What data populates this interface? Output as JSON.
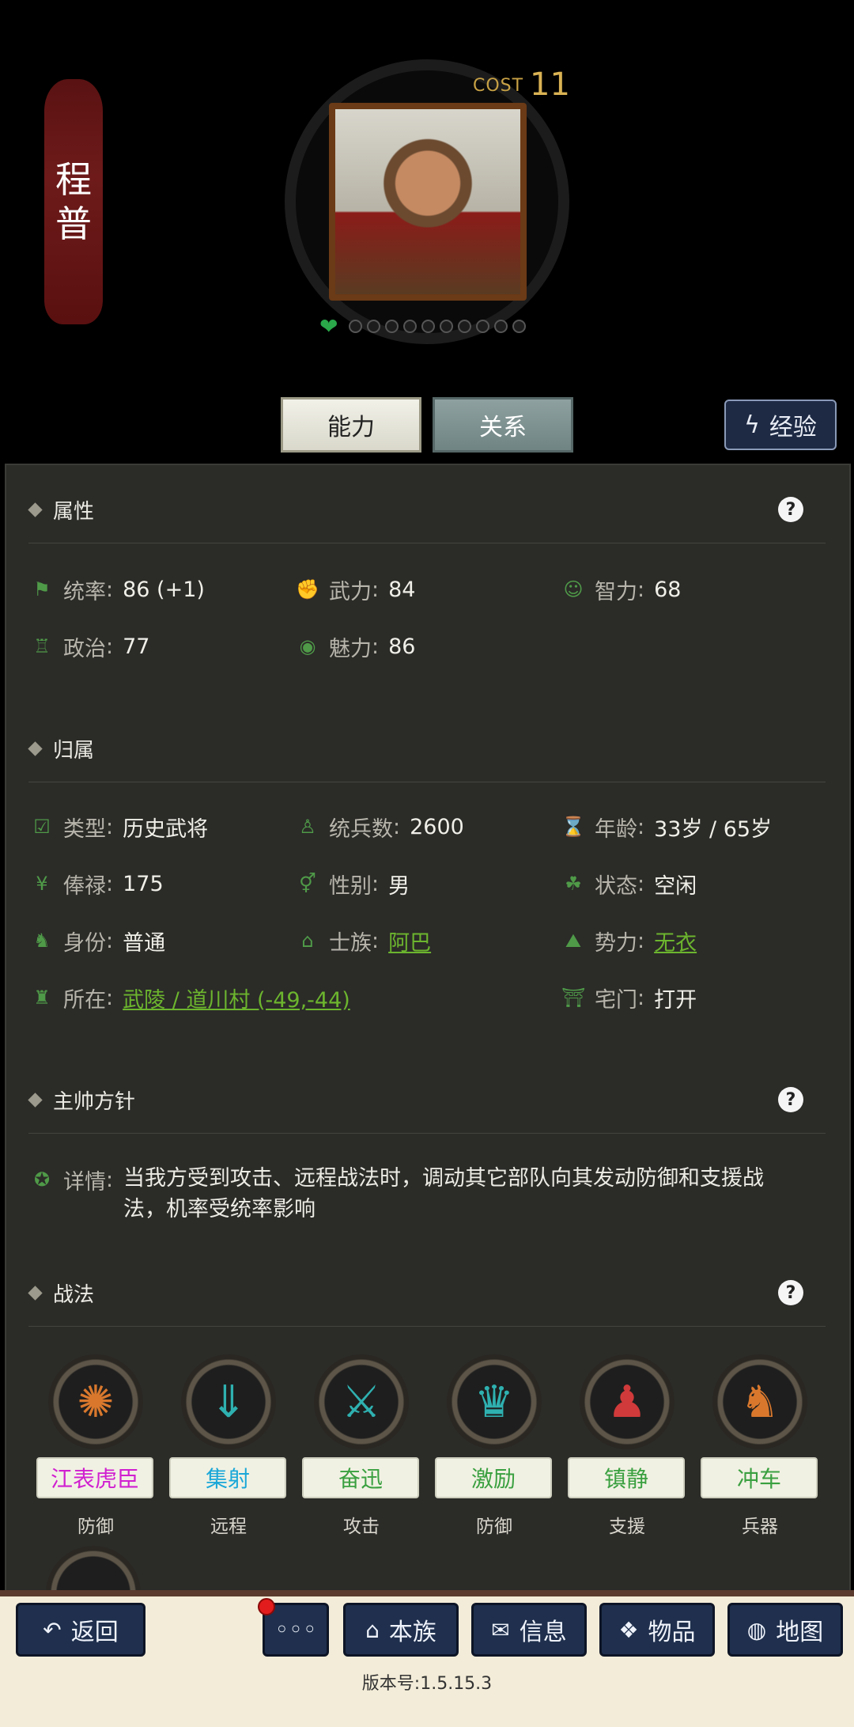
{
  "header": {
    "name_char1": "程",
    "name_char2": "普",
    "cost_label": "COST",
    "cost_value": "11",
    "star_count": 10
  },
  "tabs": {
    "ability": "能力",
    "relation": "关系",
    "experience": "经验"
  },
  "sections": {
    "attributes": {
      "title": "属性",
      "items": [
        {
          "label": "统率",
          "value": "86 (+1)",
          "icon": "flag-icon"
        },
        {
          "label": "武力",
          "value": "84",
          "icon": "arm-icon"
        },
        {
          "label": "智力",
          "value": "68",
          "icon": "brain-head-icon"
        },
        {
          "label": "政治",
          "value": "77",
          "icon": "bag-icon"
        },
        {
          "label": "魅力",
          "value": "86",
          "icon": "eye-icon"
        }
      ]
    },
    "affiliation": {
      "title": "归属",
      "type": {
        "label": "类型",
        "value": "历史武将"
      },
      "troops": {
        "label": "统兵数",
        "value": "2600"
      },
      "age": {
        "label": "年龄",
        "value": "33岁 / 65岁"
      },
      "salary": {
        "label": "俸禄",
        "value": "175"
      },
      "gender": {
        "label": "性别",
        "value": "男"
      },
      "status": {
        "label": "状态",
        "value": "空闲"
      },
      "identity": {
        "label": "身份",
        "value": "普通"
      },
      "clan": {
        "label": "士族",
        "value": "阿巴"
      },
      "faction": {
        "label": "势力",
        "value": "无衣"
      },
      "location": {
        "label": "所在",
        "value": "武陵 / 道川村 (-49,-44)"
      },
      "mansion": {
        "label": "宅门",
        "value": "打开"
      }
    },
    "strategy": {
      "title": "主帅方针",
      "detail_label": "详情",
      "detail_text": "当我方受到攻击、远程战法时，调动其它部队向其发动防御和支援战法，机率受统率影响"
    },
    "tactics": {
      "title": "战法",
      "skills": [
        {
          "name": "江表虎臣",
          "type": "防御",
          "color": "#d020d0",
          "icon": "brain-icon"
        },
        {
          "name": "集射",
          "type": "远程",
          "color": "#1aa7d8",
          "icon": "arrow-rain-icon"
        },
        {
          "name": "奋迅",
          "type": "攻击",
          "color": "#3aa040",
          "icon": "crossed-swords-icon"
        },
        {
          "name": "激励",
          "type": "防御",
          "color": "#3aa040",
          "icon": "warrior-icon"
        },
        {
          "name": "镇静",
          "type": "支援",
          "color": "#3aa040",
          "icon": "meditate-icon"
        },
        {
          "name": "冲车",
          "type": "兵器",
          "color": "#3aa040",
          "icon": "siege-horse-icon"
        }
      ]
    }
  },
  "bottom_bar": {
    "back": "返回",
    "more": "◦◦◦",
    "clan": "本族",
    "info": "信息",
    "items": "物品",
    "map": "地图",
    "version": "版本号:1.5.15.3"
  },
  "colors": {
    "link": "#6cb52e",
    "accent_icon": "#4f9a48",
    "panel_bg": "#2b2b28"
  }
}
